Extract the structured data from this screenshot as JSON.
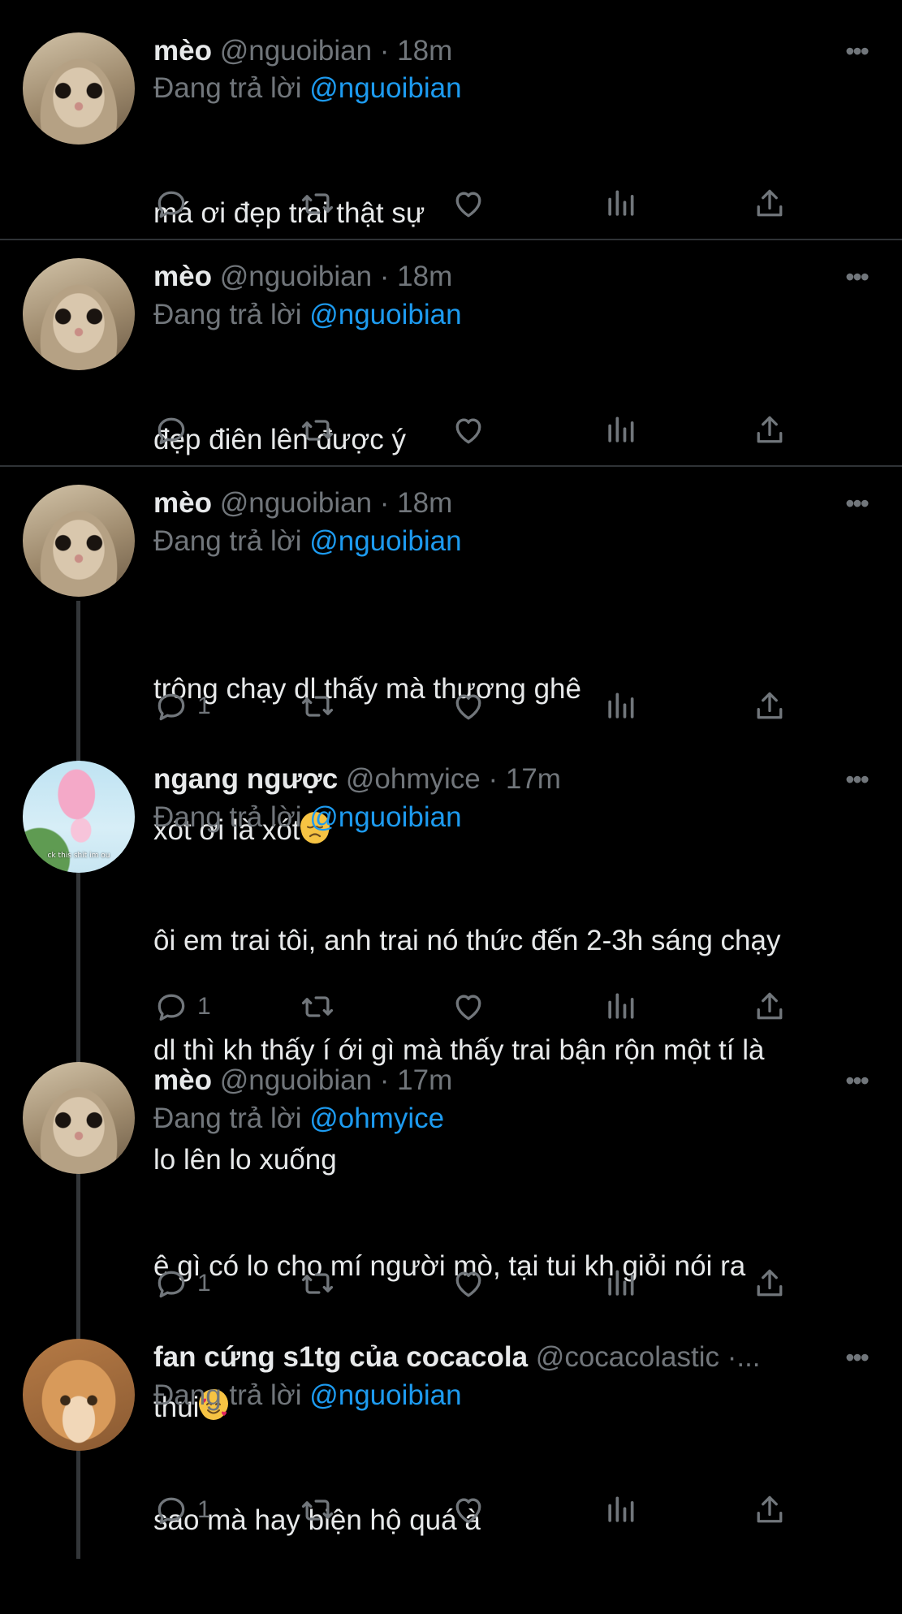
{
  "tweets": [
    {
      "name": "mèo",
      "handle": "@nguoibian",
      "sep": " · ",
      "time": "18m",
      "replying_prefix": "Đang trả lời ",
      "replying_to": "@nguoibian",
      "text_lines": [
        "má ơi đẹp trai thật sự"
      ],
      "reply_count": "",
      "avatar": "cat"
    },
    {
      "name": "mèo",
      "handle": "@nguoibian",
      "sep": " · ",
      "time": "18m",
      "replying_prefix": "Đang trả lời ",
      "replying_to": "@nguoibian",
      "text_lines": [
        "đẹp điên lên được ý"
      ],
      "reply_count": "",
      "avatar": "cat"
    },
    {
      "name": "mèo",
      "handle": "@nguoibian",
      "sep": " · ",
      "time": "18m",
      "replying_prefix": "Đang trả lời ",
      "replying_to": "@nguoibian",
      "text_lines": [
        "trông chạy dl thấy mà thương ghê",
        "xót ơi là xót"
      ],
      "emoji_after_last_line": "disappointed-face-emoji",
      "reply_count": "1",
      "avatar": "cat"
    },
    {
      "name": "ngang ngược",
      "handle": "@ohmyice",
      "sep": " · ",
      "time": "17m",
      "replying_prefix": "Đang trả lời ",
      "replying_to": "@nguoibian",
      "text_lines": [
        "ôi em trai tôi, anh trai nó thức đến 2-3h sáng chạy",
        "dl thì kh thấy í ới gì mà thấy trai bận rộn một tí là",
        "lo lên lo xuống"
      ],
      "reply_count": "1",
      "avatar": "sky",
      "avatar_caption": "ck this shit im ou"
    },
    {
      "name": "mèo",
      "handle": "@nguoibian",
      "sep": " · ",
      "time": "17m",
      "replying_prefix": "Đang trả lời ",
      "replying_to": "@ohmyice",
      "text_lines": [
        "ê gì có lo cho mí người mò, tại tui kh giỏi nói ra",
        "thui"
      ],
      "emoji_after_last_line": "smiling-face-with-hearts-emoji",
      "reply_count": "1",
      "avatar": "cat"
    },
    {
      "name": "fan cứng s1tg của cocacola",
      "handle": "@cocacolastic",
      "sep": " ·...",
      "time": "",
      "replying_prefix": "Đang trả lời ",
      "replying_to": "@nguoibian",
      "text_lines": [
        "sao mà hay biện hộ quá à"
      ],
      "reply_count": "1",
      "avatar": "orange"
    }
  ],
  "icons": {
    "reply": "reply-icon",
    "retweet": "retweet-icon",
    "like": "heart-icon",
    "views": "views-icon",
    "share": "share-icon",
    "more": "more-options-icon"
  },
  "colors": {
    "background": "#000000",
    "text": "#e7e9ea",
    "muted": "#71767b",
    "accent": "#1d9bf0",
    "divider": "#2f3336"
  }
}
